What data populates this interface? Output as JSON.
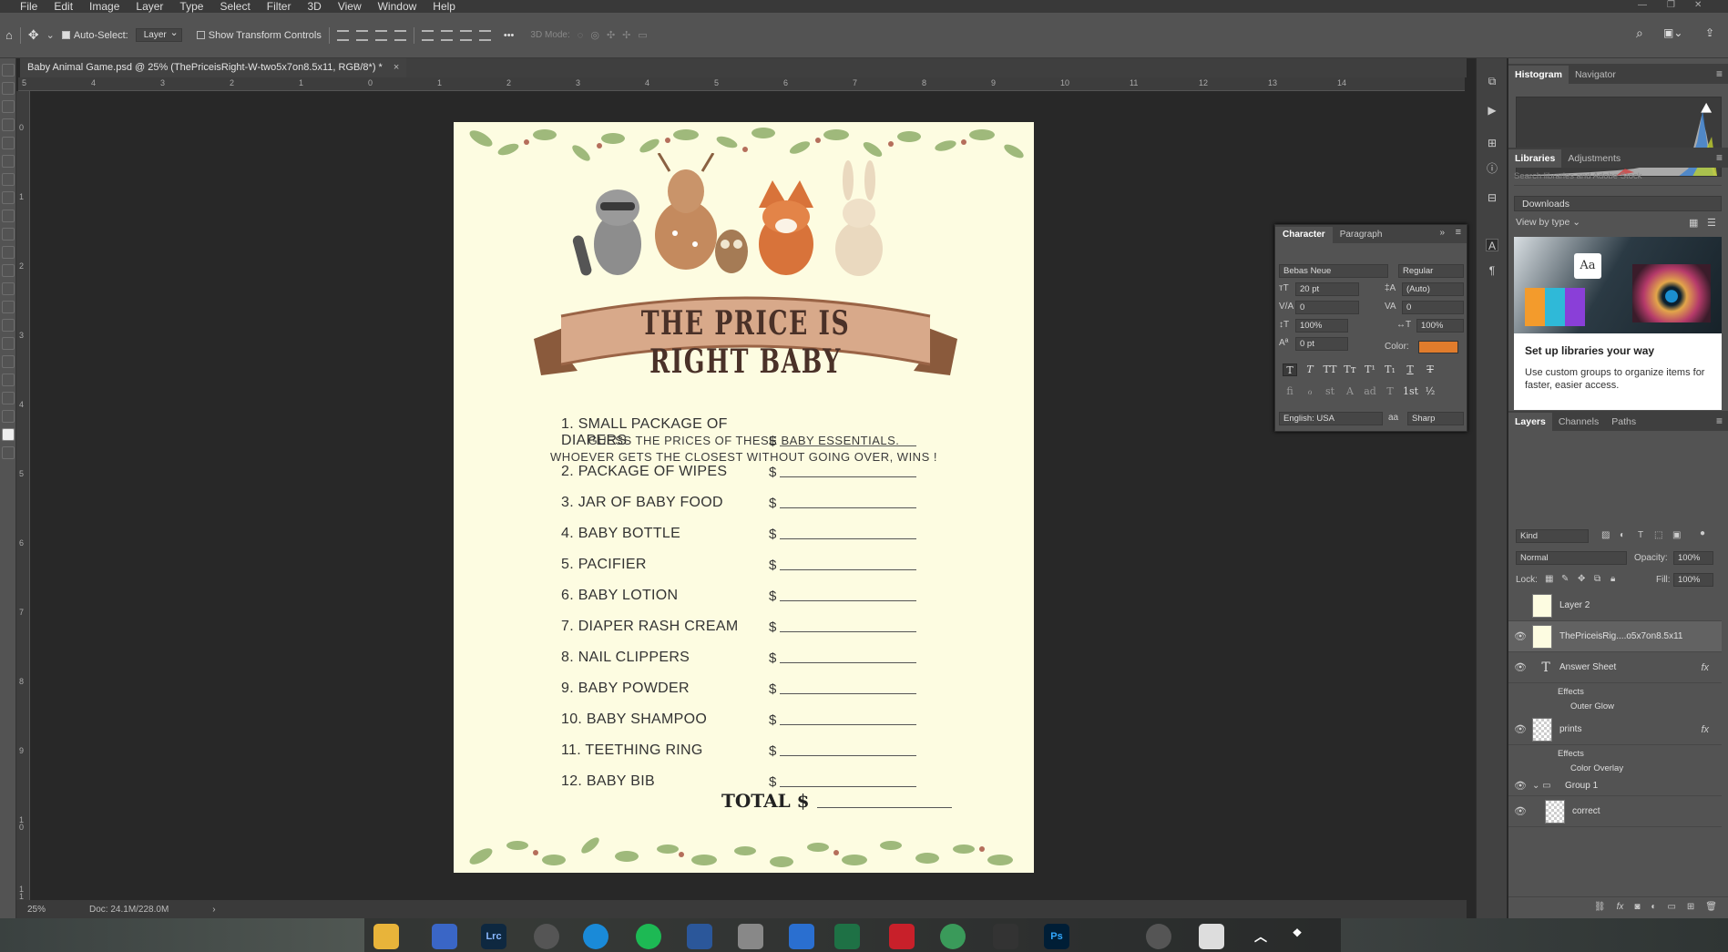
{
  "menu": [
    "File",
    "Edit",
    "Image",
    "Layer",
    "Type",
    "Select",
    "Filter",
    "3D",
    "View",
    "Window",
    "Help"
  ],
  "options": {
    "auto_select": "Auto-Select:",
    "layer_dropdown": "Layer",
    "show_transform": "Show Transform Controls",
    "mode_3d": "3D Mode:",
    "more": "•••"
  },
  "doc_tab": {
    "title": "Baby Animal Game.psd @ 25% (ThePriceisRight-W-two5x7on8.5x11, RGB/8*) *",
    "close": "×"
  },
  "ruler_top": [
    "5",
    "4",
    "3",
    "2",
    "1",
    "0",
    "1",
    "2",
    "3",
    "4",
    "5",
    "6",
    "7",
    "8",
    "9",
    "10",
    "11",
    "12",
    "13",
    "14"
  ],
  "ruler_left": [
    "0",
    "1",
    "2",
    "3",
    "4",
    "5",
    "6",
    "7",
    "8",
    "9",
    "1\n0",
    "1\n1"
  ],
  "status": {
    "zoom": "25%",
    "doc": "Doc: 24.1M/228.0M",
    "arrow": "›"
  },
  "document": {
    "banner": "THE PRICE IS RIGHT BABY",
    "subtitle_1": "GUESS THE PRICES OF THESE BABY ESSENTIALS.",
    "subtitle_2": "WHOEVER GETS THE CLOSEST WITHOUT GOING OVER, WINS !",
    "dollar": "$",
    "items": [
      "1. SMALL PACKAGE OF DIAPERS",
      "2. PACKAGE OF WIPES",
      "3. JAR OF BABY FOOD",
      "4. BABY BOTTLE",
      "5. PACIFIER",
      "6. BABY LOTION",
      "7. DIAPER RASH CREAM",
      "8. NAIL CLIPPERS",
      "9. BABY POWDER",
      "10. BABY SHAMPOO",
      "11. TEETHING RING",
      "12. BABY BIB"
    ],
    "total": "TOTAL $"
  },
  "character": {
    "tab_char": "Character",
    "tab_para": "Paragraph",
    "font": "Bebas Neue",
    "style": "Regular",
    "size": "20 pt",
    "leading": "(Auto)",
    "kerning": "0",
    "tracking": "0",
    "vscale": "100%",
    "hscale": "100%",
    "baseline": "0 pt",
    "color_label": "Color:",
    "color": "#e07c2c",
    "language": "English: USA",
    "aa_label": "aa",
    "aa": "Sharp",
    "type_buttons": [
      "T",
      "T",
      "TT",
      "Tт",
      "T¹",
      "T₁",
      "T",
      "T"
    ],
    "ot_buttons": [
      "fi",
      "ℴ",
      "st",
      "A",
      "ad",
      "T",
      "1st",
      "½"
    ]
  },
  "histogram": {
    "tab1": "Histogram",
    "tab2": "Navigator"
  },
  "libraries": {
    "tab1": "Libraries",
    "tab2": "Adjustments",
    "search_placeholder": "Search libraries and Adobe Stock",
    "dropdown": "Downloads",
    "view_by": "View by type ⌄",
    "card_title": "Set up libraries your way",
    "card_text": "Use custom groups to organize items for faster, easier access."
  },
  "layers": {
    "tab1": "Layers",
    "tab2": "Channels",
    "tab3": "Paths",
    "kind": "Kind",
    "blend": "Normal",
    "opacity_label": "Opacity:",
    "opacity": "100%",
    "lock_label": "Lock:",
    "fill_label": "Fill:",
    "fill": "100%",
    "rows": [
      {
        "name": "Layer 2"
      },
      {
        "name": "ThePriceisRig....o5x7on8.5x11"
      },
      {
        "name": "Answer Sheet"
      },
      {
        "name": "prints"
      },
      {
        "name": "Group 1"
      },
      {
        "name": "correct"
      }
    ],
    "effects": "Effects",
    "outer_glow": "Outer Glow",
    "color_overlay": "Color Overlay",
    "fx": "fx"
  },
  "taskbar": {
    "lrc": "Lrc",
    "ps": "Ps"
  }
}
